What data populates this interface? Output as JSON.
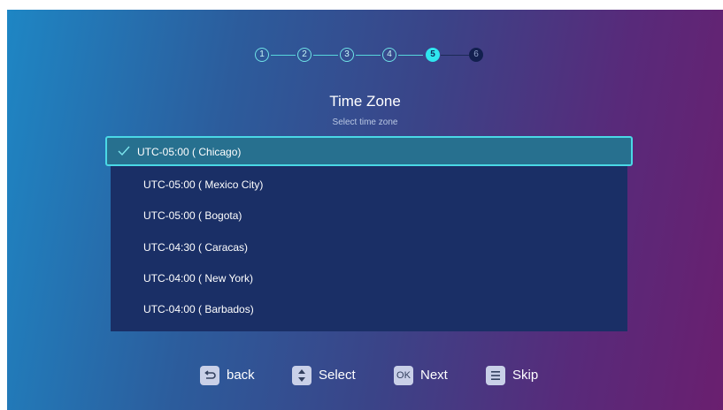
{
  "stepper": {
    "steps": [
      "1",
      "2",
      "3",
      "4",
      "5",
      "6"
    ],
    "current_step": 5
  },
  "header": {
    "title": "Time Zone",
    "subtitle": "Select time zone"
  },
  "timezone_list": {
    "selected": "UTC-05:00 ( Chicago)",
    "items": [
      "UTC-05:00 ( Mexico City)",
      "UTC-05:00 ( Bogota)",
      "UTC-04:30 ( Caracas)",
      "UTC-04:00 ( New York)",
      "UTC-04:00 ( Barbados)"
    ]
  },
  "footer": {
    "back_label": "back",
    "select_label": "Select",
    "ok_key": "OK",
    "next_label": "Next",
    "skip_label": "Skip"
  },
  "colors": {
    "accent": "#2fe6ef",
    "selected_row": "#27708f",
    "list_bg": "#1a2f66"
  }
}
